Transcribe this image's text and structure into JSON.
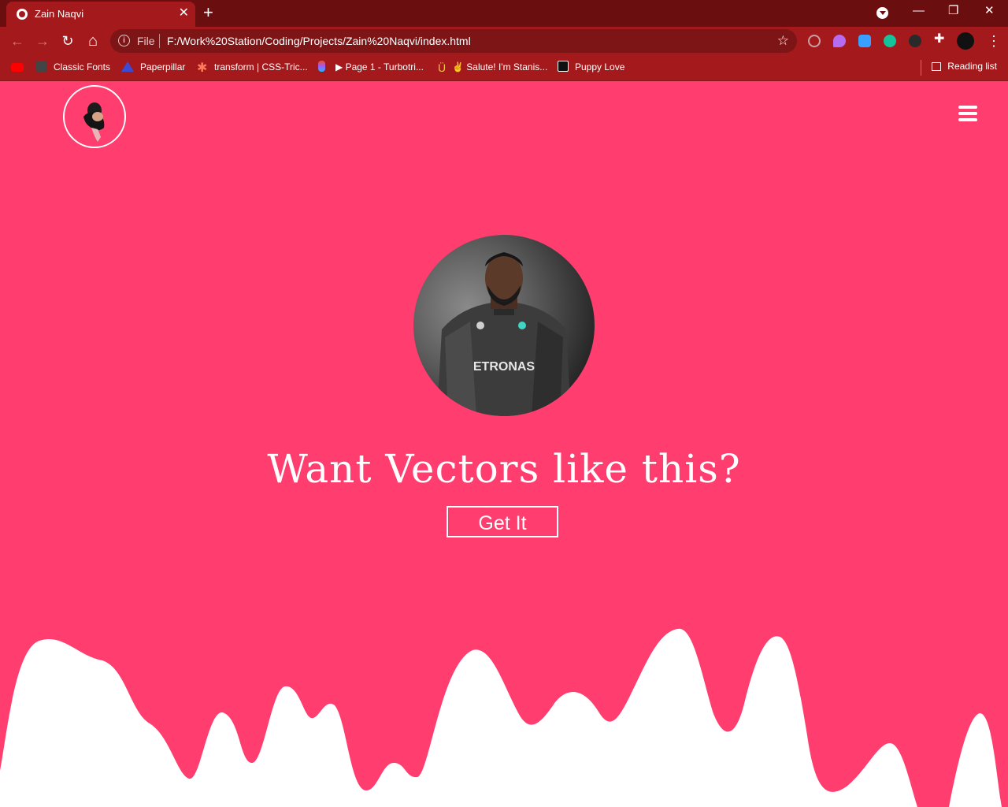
{
  "browser": {
    "tab_title": "Zain Naqvi",
    "tab_close": "✕",
    "new_tab": "+",
    "controls": {
      "minimize": "—",
      "restore": "❐",
      "close": "✕"
    },
    "nav": {
      "back": "←",
      "forward": "→",
      "reload": "↻",
      "home": "⌂"
    },
    "address": {
      "scheme": "File",
      "url": "F:/Work%20Station/Coding/Projects/Zain%20Naqvi/index.html",
      "bookmark_star": "☆"
    },
    "menu": "⋮"
  },
  "bookmarks": [
    {
      "label": "",
      "icon": "youtube-icon",
      "color": "#ff0000"
    },
    {
      "label": "Classic Fonts",
      "icon": "sg-icon",
      "color": "#333333"
    },
    {
      "label": "Paperpillar",
      "icon": "paperpillar-icon",
      "color": "#3b4bd6"
    },
    {
      "label": "transform | CSS-Tric...",
      "icon": "css-tricks-icon",
      "color": "#ff7a59"
    },
    {
      "label": "",
      "icon": "figma-icon",
      "color": "#a259ff"
    },
    {
      "label": "▶ Page 1 - Turbotri...",
      "icon": "",
      "color": ""
    },
    {
      "label": "✌ Salute! I'm Stanis...",
      "icon": "stanis-icon",
      "color": "#f5c542"
    },
    {
      "label": "Puppy Love",
      "icon": "puppy-love-icon",
      "color": "#111111"
    }
  ],
  "reading_list": "Reading list",
  "site": {
    "headline": "Want Vectors like this?",
    "cta": "Get It",
    "logo": "avatar-logo-icon",
    "menu_icon": "hamburger-menu-icon"
  },
  "colors": {
    "chrome_dark": "#6a0e10",
    "chrome": "#a3191c",
    "page_bg": "#ff3d6e",
    "wave": "#ffffff"
  }
}
